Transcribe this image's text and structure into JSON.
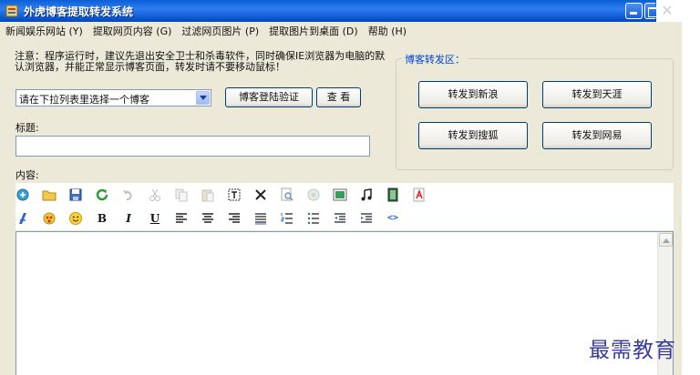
{
  "window": {
    "title": "外虎博客提取转发系统"
  },
  "menu": [
    "新闻娱乐网站 (Y)",
    "提取网页内容 (G)",
    "过滤网页图片 (P)",
    "提取图片到桌面 (D)",
    "帮助 (H)"
  ],
  "notice": {
    "text": "注意：程序运行时，建议先退出安全卫士和杀毒软件，同时确保IE浏览器为电脑的默认浏览器，并能正常显示博客页面，转发时请不要移动鼠标！"
  },
  "blog_select": {
    "selected": "请在下拉列表里选择一个博客"
  },
  "buttons": {
    "verify": "博客登陆验证",
    "view": "查 看"
  },
  "title_field": {
    "label": "标题:",
    "value": ""
  },
  "content_label": "内容:",
  "forward_group": {
    "legend": "博客转发区：",
    "sina": "转发到新浪",
    "tianya": "转发到天涯",
    "sohu": "转发到搜狐",
    "netease": "转发到网易"
  },
  "format_glyphs": {
    "bold": "B",
    "italic": "I",
    "underline": "U",
    "source": "<>"
  },
  "icons": {
    "toolbar_row1": [
      "new-document-icon",
      "open-folder-icon",
      "save-icon",
      "refresh-icon",
      "undo-icon",
      "cut-icon",
      "copy-icon",
      "paste-icon",
      "select-all-icon",
      "delete-icon",
      "find-icon",
      "replace-icon",
      "image-icon",
      "music-icon",
      "video-icon",
      "flash-icon"
    ],
    "toolbar_row2": [
      "font-color-icon",
      "emoticon-icon",
      "smiley-icon",
      "bold-icon",
      "italic-icon",
      "underline-icon",
      "align-left-icon",
      "align-center-icon",
      "align-right-icon",
      "justify-icon",
      "ordered-list-icon",
      "unordered-list-icon",
      "outdent-icon",
      "indent-icon",
      "source-code-icon"
    ]
  },
  "watermark": "最需教育",
  "colors": {
    "titlebar": "#0a5fd8",
    "window_bg": "#ece9d8",
    "group_legend": "#0046d5",
    "watermark": "#3a3aa0"
  }
}
